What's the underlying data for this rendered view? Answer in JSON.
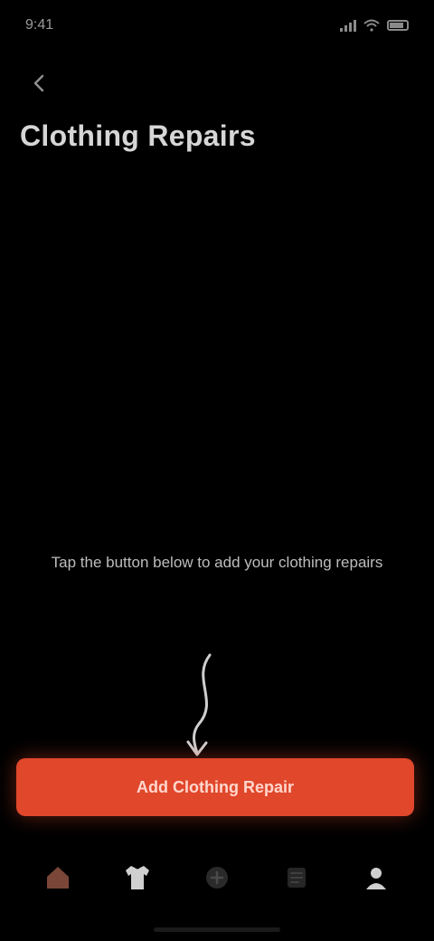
{
  "status_bar": {
    "time": "9:41"
  },
  "header": {
    "back_icon": "chevron-left-icon",
    "title": "Clothing Repairs"
  },
  "empty_state": {
    "message": "Tap the button below to add your clothing repairs"
  },
  "cta": {
    "label": "Add Clothing Repair"
  },
  "bottom_nav": {
    "items": [
      {
        "icon": "home-icon",
        "active": true
      },
      {
        "icon": "shirt-icon",
        "active": false
      },
      {
        "icon": "add-icon",
        "active": false
      },
      {
        "icon": "list-icon",
        "active": false
      },
      {
        "icon": "profile-icon",
        "active": false
      }
    ]
  },
  "colors": {
    "background": "#000000",
    "accent": "#e0472b",
    "nav_active": "#7a4638",
    "nav_icon": "#d0d0d0"
  }
}
